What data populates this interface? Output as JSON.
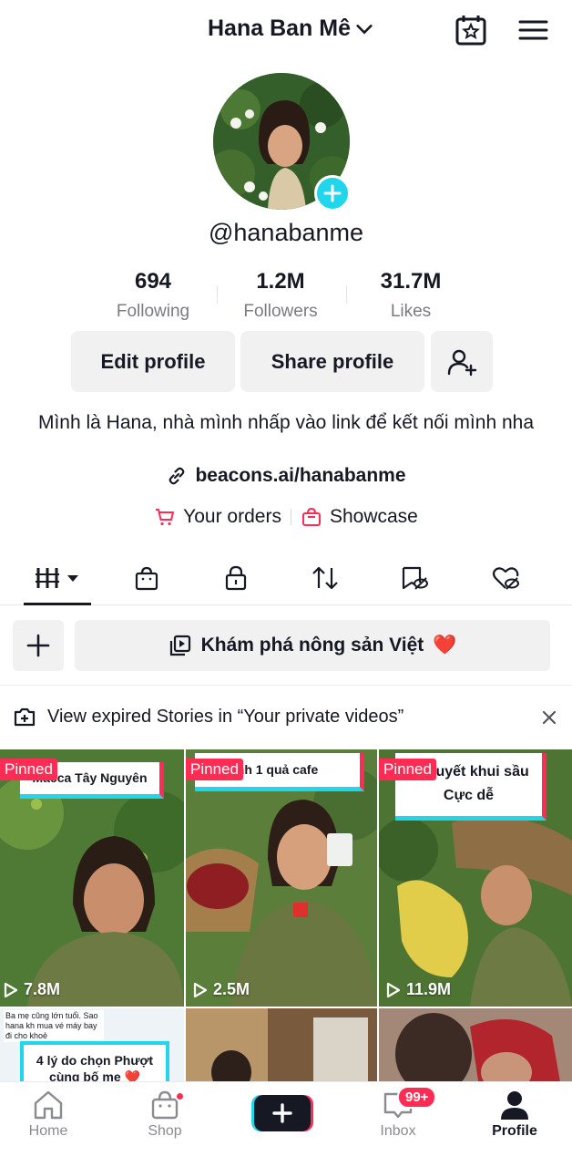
{
  "header": {
    "account_name": "Hana Ban Mê",
    "icons": [
      "calendar-star-icon",
      "menu-icon"
    ]
  },
  "profile": {
    "username": "@hanabanme",
    "stats": [
      {
        "value": "694",
        "label": "Following"
      },
      {
        "value": "1.2M",
        "label": "Followers"
      },
      {
        "value": "31.7M",
        "label": "Likes"
      }
    ],
    "buttons": {
      "edit": "Edit profile",
      "share": "Share profile"
    },
    "bio": "Mình là Hana, nhà mình nhấp vào link để kết nối mình nha",
    "link": "beacons.ai/hanabanme",
    "orders": "Your orders",
    "showcase": "Showcase"
  },
  "tabs": [
    "videos-grid",
    "shop",
    "private",
    "repost",
    "favorites",
    "liked"
  ],
  "playlist": {
    "title": "Khám phá nông sản Việt",
    "emoji": "❤️"
  },
  "stories_notice": "View expired Stories in “Your private videos”",
  "videos": [
    {
      "pinned": "Pinned",
      "caption": "Macca Tây Nguyên",
      "views": "7.8M"
    },
    {
      "pinned": "Pinned",
      "caption": "nh 1 quả cafe",
      "views": "2.5M"
    },
    {
      "pinned": "Pinned",
      "caption": "Bí quyết khui sầu Cực dễ",
      "views": "11.9M"
    },
    {
      "caption_small": "Ba mẹ cũng lớn tuổi. Sao hana kh mua vé máy bay đi cho khoẻ",
      "caption": "4 lý do chọn Phượt cùng bố mẹ ❤️"
    },
    {
      "caption": ""
    },
    {
      "caption": ""
    }
  ],
  "nav": {
    "home": "Home",
    "shop": "Shop",
    "inbox": "Inbox",
    "inbox_badge": "99+",
    "profile": "Profile"
  },
  "colors": {
    "accent_red": "#fe2c55",
    "accent_cyan": "#20d5ec",
    "text": "#161823",
    "muted": "#7a7b80"
  }
}
